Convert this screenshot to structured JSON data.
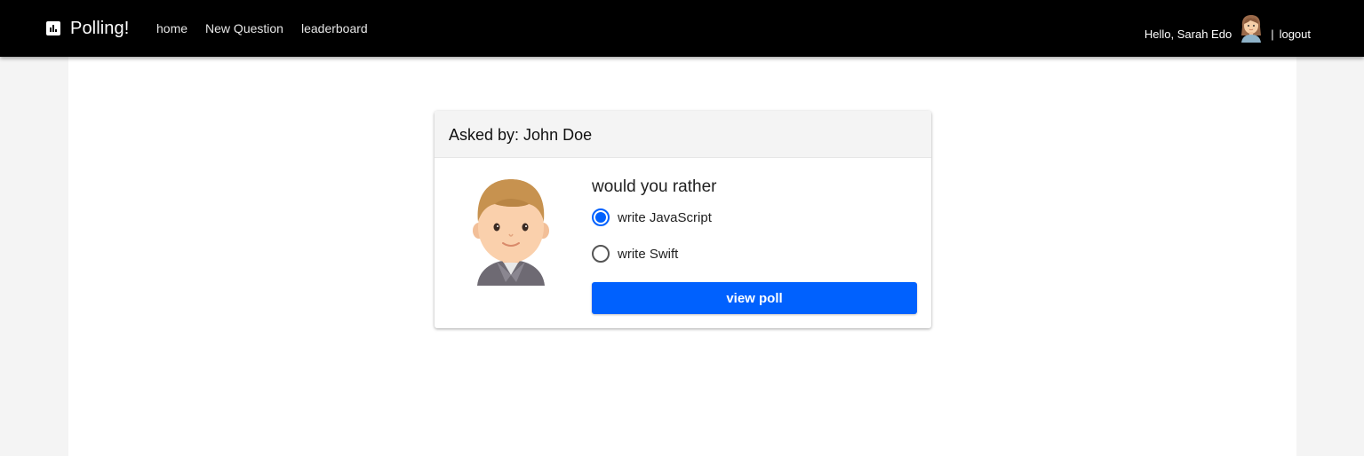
{
  "navbar": {
    "brand": "Polling!",
    "brand_icon": "bar-chart-icon",
    "links": [
      "home",
      "New Question",
      "leaderboard"
    ],
    "greeting": "Hello, Sarah Edo",
    "separator": "|",
    "logout_label": "logout",
    "background": "#000000"
  },
  "card": {
    "header": "Asked by: John Doe",
    "question": "would you rather",
    "options": [
      {
        "label": "write JavaScript",
        "selected": true
      },
      {
        "label": "write Swift",
        "selected": false
      }
    ],
    "button_label": "view poll",
    "accent": "#0061fe"
  }
}
